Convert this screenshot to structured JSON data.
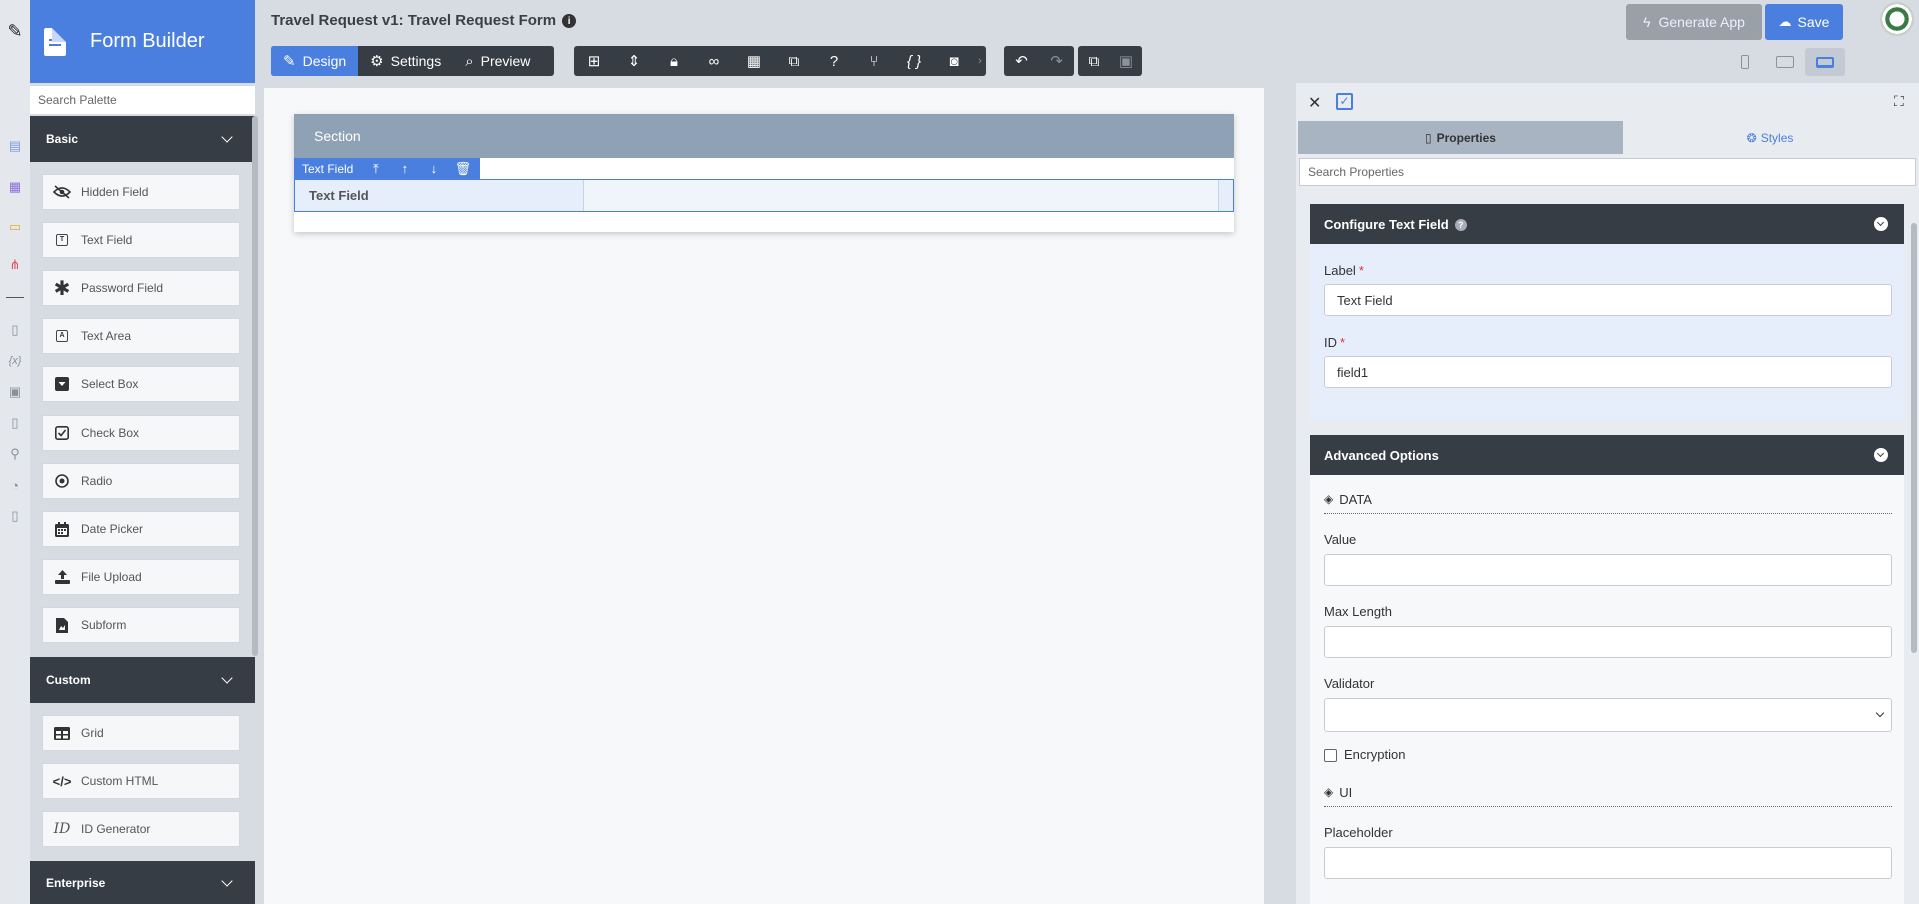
{
  "app": {
    "title": "Form Builder"
  },
  "palette": {
    "search_placeholder": "Search Palette",
    "categories": {
      "basic": "Basic",
      "custom": "Custom",
      "enterprise": "Enterprise"
    },
    "basic_items": [
      {
        "label": "Hidden Field",
        "icon": "eye-slash-icon"
      },
      {
        "label": "Text Field",
        "icon": "text-field-icon"
      },
      {
        "label": "Password Field",
        "icon": "asterisk-icon"
      },
      {
        "label": "Text Area",
        "icon": "text-area-icon"
      },
      {
        "label": "Select Box",
        "icon": "select-box-icon"
      },
      {
        "label": "Check Box",
        "icon": "check-box-icon"
      },
      {
        "label": "Radio",
        "icon": "radio-icon"
      },
      {
        "label": "Date Picker",
        "icon": "calendar-icon"
      },
      {
        "label": "File Upload",
        "icon": "upload-icon"
      },
      {
        "label": "Subform",
        "icon": "subform-icon"
      }
    ],
    "custom_items": [
      {
        "label": "Grid",
        "icon": "grid-icon"
      },
      {
        "label": "Custom HTML",
        "icon": "code-icon"
      },
      {
        "label": "ID Generator",
        "icon": "id-icon"
      }
    ]
  },
  "header": {
    "form_title": "Travel Request v1: Travel Request Form",
    "tabs": {
      "design": "Design",
      "settings": "Settings",
      "preview": "Preview"
    },
    "generate_app": "Generate App",
    "save": "Save"
  },
  "canvas": {
    "section_title": "Section",
    "selected_field_type": "Text Field",
    "field_label": "Text Field"
  },
  "properties": {
    "tabs": {
      "properties": "Properties",
      "styles": "Styles"
    },
    "search_placeholder": "Search Properties",
    "configure": {
      "title": "Configure Text Field",
      "label_label": "Label",
      "label_value": "Text Field",
      "id_label": "ID",
      "id_value": "field1",
      "required_mark": "*"
    },
    "advanced": {
      "title": "Advanced Options",
      "data_heading": "DATA",
      "value_label": "Value",
      "max_length_label": "Max Length",
      "validator_label": "Validator",
      "encryption_label": "Encryption",
      "ui_heading": "UI",
      "placeholder_label": "Placeholder"
    }
  },
  "colors": {
    "accent": "#4a7fe0",
    "dark": "#363d45",
    "section_header": "#8fa1b5"
  }
}
